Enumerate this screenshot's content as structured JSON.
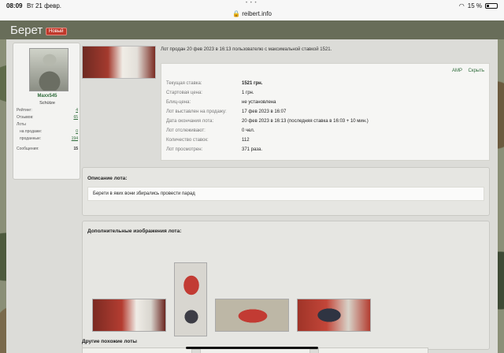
{
  "status_bar": {
    "time": "08:09",
    "date": "Вт 21 февр.",
    "url": "reibert.info",
    "battery": "15 %"
  },
  "page": {
    "title": "Берет",
    "badge": "Новый"
  },
  "user": {
    "name": "Maxx545",
    "rank": "Schütze",
    "rating_label": "Рейтинг:",
    "rating_value": "4",
    "reviews_label": "Отзывов:",
    "reviews_value": "65",
    "lots_label": "Лоты",
    "on_sale_label": "на продаже:",
    "on_sale_value": "0",
    "sold_label": "проданные:",
    "sold_value": "194",
    "messages_label": "Сообщения:",
    "messages_value": "15"
  },
  "lot": {
    "sold_text": "Лот продан 20 фев 2023 в 16:13 пользователю с максимальной ставкой 1521.",
    "links": {
      "amp": "AMP",
      "hide": "Скрыть"
    },
    "rows": [
      {
        "label": "Текущая ставка:",
        "value": "1521 грн."
      },
      {
        "label": "Стартовая цена:",
        "value": "1 грн."
      },
      {
        "label": "Блиц-цена:",
        "value": "не установлена"
      },
      {
        "label": "Лот выставлен на продажу:",
        "value": "17 фев 2023 в 16:07"
      },
      {
        "label": "Дата окончания лота:",
        "value": "20 фев 2023 в 16:13 (последняя ставка в 16:03 + 10 мин.)"
      },
      {
        "label": "Лот отслеживают:",
        "value": "0 чел."
      },
      {
        "label": "Количество ставок:",
        "value": "112"
      },
      {
        "label": "Лот просмотрен:",
        "value": "371 раза."
      }
    ]
  },
  "description": {
    "title": "Описание лота:",
    "text": "Берети в яких вони збирались провести парад"
  },
  "additional_images": {
    "title": "Дополнительные изображения лота:"
  },
  "similar": {
    "title": "Другие похожие лоты"
  }
}
